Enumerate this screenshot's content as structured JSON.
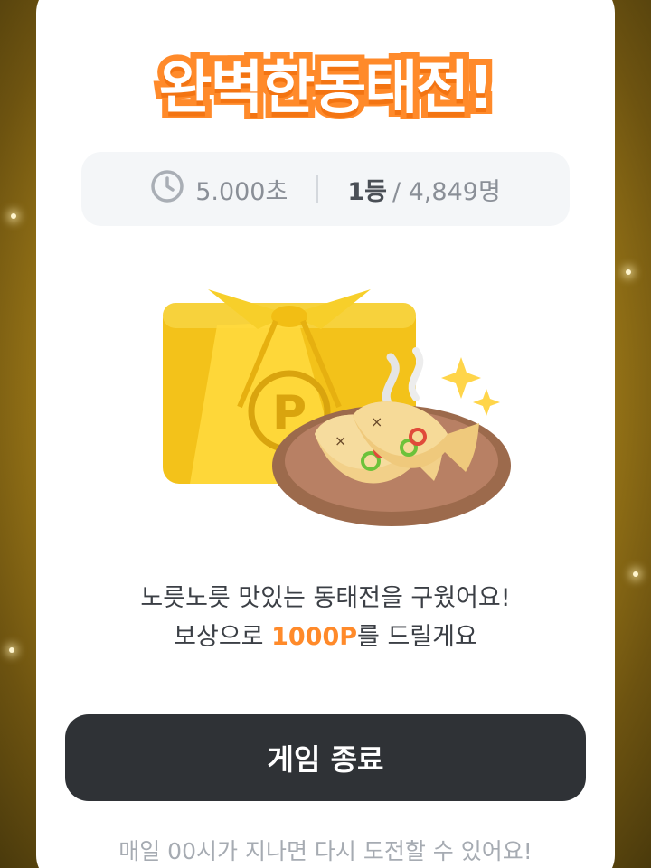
{
  "title": "완벽한동태전!",
  "stats": {
    "icon": "clock-icon",
    "time": "5.000초",
    "rank": "1등",
    "total": "/ 4,849명"
  },
  "message": {
    "line1": "노릇노릇 맛있는 동태전을 구웠어요!",
    "line2_prefix": "보상으로 ",
    "reward": "1000P",
    "line2_suffix": "를 드릴게요"
  },
  "button": {
    "label": "게임 종료"
  },
  "footnote": "매일 00시가 지나면 다시 도전할 수 있어요!",
  "colors": {
    "accent": "#ff8a2a",
    "button": "#2f3236",
    "background_gold": "#c99a22"
  },
  "illustration": {
    "gift_box_icon": "gift-box-icon",
    "point_icon": "point-coin-icon",
    "fish_plate_icon": "fish-jeon-plate-icon",
    "sparkle_icon": "sparkle-icon"
  }
}
